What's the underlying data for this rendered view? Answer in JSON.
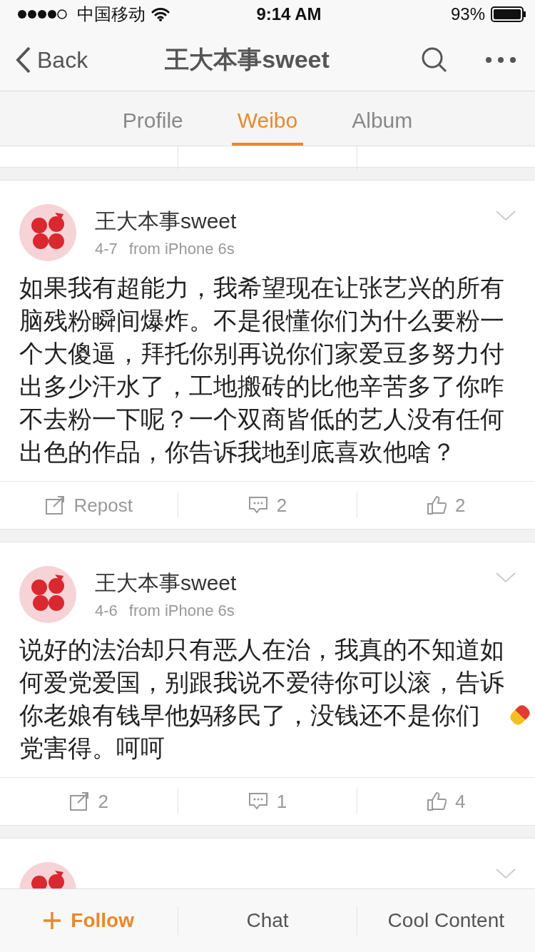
{
  "status_bar": {
    "carrier": "中国移动",
    "time": "9:14 AM",
    "battery": "93%"
  },
  "nav": {
    "back": "Back",
    "title": "王大本事sweet"
  },
  "tabs": [
    {
      "label": "Profile",
      "selected": false
    },
    {
      "label": "Weibo",
      "selected": true
    },
    {
      "label": "Album",
      "selected": false
    }
  ],
  "posts": [
    {
      "kind": "full",
      "author": "王大本事sweet",
      "date": "4-7",
      "source": "from iPhone 6s",
      "body": [
        {
          "kind": "text",
          "text": "如果我有超能力，我希望现在让张艺兴的所有脑残粉瞬间爆炸。不是很懂你们为什么要粉一个大傻逼，拜托你别再说你们家爱豆多努力付出多少汗水了，工地搬砖的比他辛苦多了你咋不去粉一下呢？一个双商皆低的艺人没有任何出色的作品，你告诉我地到底喜欢他啥？"
        }
      ],
      "actions": [
        {
          "kind": "repost",
          "label": "Repost"
        },
        {
          "kind": "comment",
          "label": "2"
        },
        {
          "kind": "like",
          "label": "2"
        }
      ]
    },
    {
      "kind": "full",
      "author": "王大本事sweet",
      "date": "4-6",
      "source": "from iPhone 6s",
      "body": [
        {
          "kind": "text",
          "text": "说好的法治却只有恶人在治，我真的不知道如何爱党爱国，别跟我说不爱待你可以滚，告诉你老娘有钱早他妈移民了，没钱还不是你们"
        },
        {
          "kind": "pill"
        },
        {
          "kind": "text",
          "text": "党害得。呵呵"
        }
      ],
      "actions": [
        {
          "kind": "repost",
          "label": "2"
        },
        {
          "kind": "comment",
          "label": "1"
        },
        {
          "kind": "like",
          "label": "4"
        }
      ]
    },
    {
      "kind": "cut"
    }
  ],
  "bottom_bar": [
    {
      "kind": "follow",
      "label": "Follow"
    },
    {
      "kind": "plain",
      "label": "Chat"
    },
    {
      "kind": "plain",
      "label": "Cool Content"
    }
  ]
}
